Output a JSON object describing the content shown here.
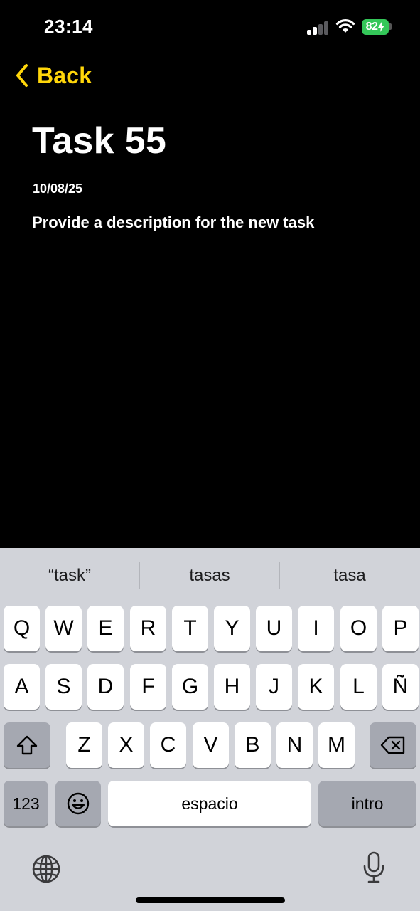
{
  "status_bar": {
    "time": "23:14",
    "battery": "82",
    "battery_color": "#34c759",
    "icons": [
      "signal-icon",
      "wifi-icon",
      "battery-charging-icon"
    ]
  },
  "nav": {
    "back_label": "Back",
    "accent_color": "#ffd60a"
  },
  "task": {
    "title": "Task 55",
    "date": "10/08/25",
    "description": "Provide a description for the new task"
  },
  "keyboard": {
    "suggestions": [
      "“task”",
      "tasas",
      "tasa"
    ],
    "row1": [
      "Q",
      "W",
      "E",
      "R",
      "T",
      "Y",
      "U",
      "I",
      "O",
      "P"
    ],
    "row2": [
      "A",
      "S",
      "D",
      "F",
      "G",
      "H",
      "J",
      "K",
      "L",
      "Ñ"
    ],
    "row3": [
      "Z",
      "X",
      "C",
      "V",
      "B",
      "N",
      "M"
    ],
    "numbers_label": "123",
    "space_label": "espacio",
    "return_label": "intro",
    "icons": [
      "shift-icon",
      "delete-icon",
      "emoji-icon",
      "globe-icon",
      "microphone-icon"
    ]
  }
}
